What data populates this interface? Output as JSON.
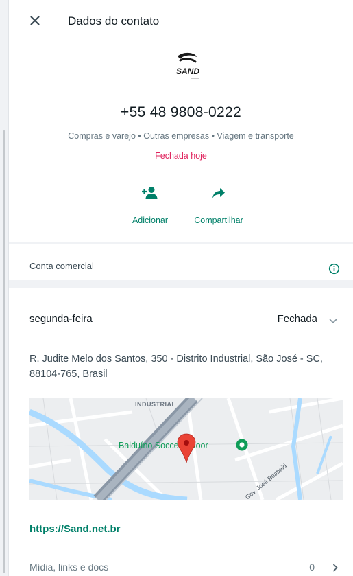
{
  "header": {
    "title": "Dados do contato"
  },
  "contact": {
    "logo_text": "SAND",
    "phone": "+55 48 9808-0222",
    "categories": "Compras e varejo • Outras empresas • Viagem e transporte",
    "status": "Fechada hoje"
  },
  "actions": {
    "add_label": "Adicionar",
    "share_label": "Compartilhar"
  },
  "business": {
    "label": "Conta comercial"
  },
  "hours": {
    "day": "segunda-feira",
    "status": "Fechada"
  },
  "address": "R. Judite Melo dos Santos, 350 - Distrito Industrial, São José - SC, 88104-765, Brasil",
  "map": {
    "area_label": "INDUSTRIAL",
    "place_label": "Balduíno Soccer Indoor",
    "street_label": "Gov. José Boabaid"
  },
  "website": "https://Sand.net.br",
  "media": {
    "label": "Mídia, links e docs",
    "count": "0"
  },
  "colors": {
    "accent": "#008069",
    "status_closed": "#e0245e",
    "divider": "#f0f2f5",
    "pin": "#ea4335"
  },
  "icons": {
    "close": "close-icon",
    "add": "add-contact-icon",
    "share": "share-icon",
    "info": "info-icon",
    "chevron_down": "chevron-down-icon",
    "chevron_right": "chevron-right-icon",
    "pin": "map-pin-icon",
    "place": "place-marker-icon"
  }
}
